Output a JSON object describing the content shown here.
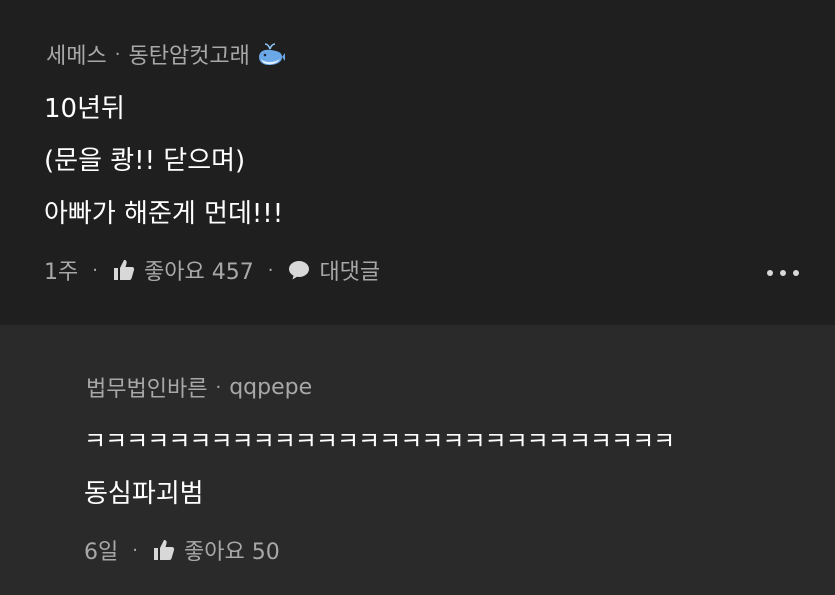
{
  "top_comment": {
    "author": "세메스",
    "separator": "·",
    "nickname": "동탄암컷고래",
    "lines": [
      "10년뒤",
      "(문을 쾅!! 닫으며)",
      "아빠가 해준게 먼데!!!"
    ],
    "time": "1주",
    "like_label": "좋아요 457",
    "reply_label": "대댓글",
    "icons": {
      "badge": "whale-icon",
      "like": "thumbs-up-icon",
      "reply": "speech-bubble-icon",
      "more": "more-options-icon"
    }
  },
  "reply_comment": {
    "author": "법무법인바른",
    "separator": "·",
    "nickname": "qqpepe",
    "lines": [
      "ㅋㅋㅋㅋㅋㅋㅋㅋㅋㅋㅋㅋㅋㅋㅋㅋㅋㅋㅋㅋㅋㅋㅋㅋㅋㅋㅋㅋ",
      "동심파괴범"
    ],
    "time": "6일",
    "like_label": "좋아요 50",
    "icons": {
      "like": "thumbs-up-icon"
    }
  },
  "colors": {
    "background_top": "#1f1f1f",
    "background_reply": "#2a2a2a",
    "meta_text": "#a8a8a8",
    "body_text": "#ffffff"
  }
}
